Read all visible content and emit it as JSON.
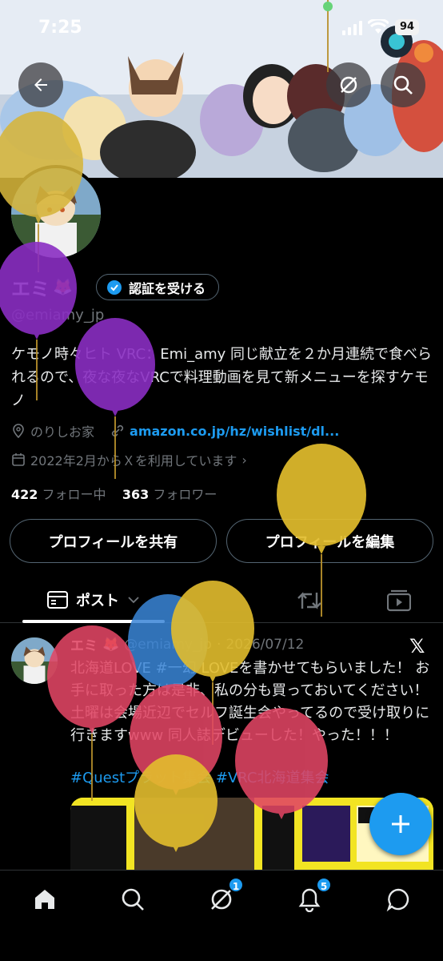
{
  "status_bar": {
    "time": "7:25",
    "battery": "94"
  },
  "profile": {
    "display_name": "エミ",
    "handle": "@emiamy_jp",
    "verify_label": "認証を受ける",
    "bio": "ケモノ時々ヒト VRC：Emi_amy 同じ献立を２か月連続で食べられるので、夜な夜なVRCで料理動画を見て新メニューを探すケモノ",
    "location": "のりしお家",
    "link": "amazon.co.jp/hz/wishlist/dl...",
    "joined": "2022年2月からＸを利用しています",
    "following_count": "422",
    "following_label": "フォロー中",
    "followers_count": "363",
    "followers_label": "フォロワー"
  },
  "actions": {
    "share": "プロフィールを共有",
    "edit": "プロフィールを編集"
  },
  "tabs": {
    "posts": "ポスト"
  },
  "post": {
    "name": "エミ",
    "handle": "@emiamy_jp",
    "date": "2026/07/12",
    "text": "北海道LOVE #一幻 LOVEを書かせてもらいました！ お手に取った方は是非、私の分も買っておいてください！土曜は会場近辺でセルフ誕生会やってるので受け取りに行きますwww 同人誌デビューした！やった！！！",
    "hashtags": "#Questプラット集会 #VRC北海道集会"
  },
  "bottom_nav": {
    "messages_badge": "1",
    "notifications_badge": "5"
  },
  "colors": {
    "accent": "#1d9bf0",
    "background": "#000000",
    "muted": "#71767b"
  }
}
